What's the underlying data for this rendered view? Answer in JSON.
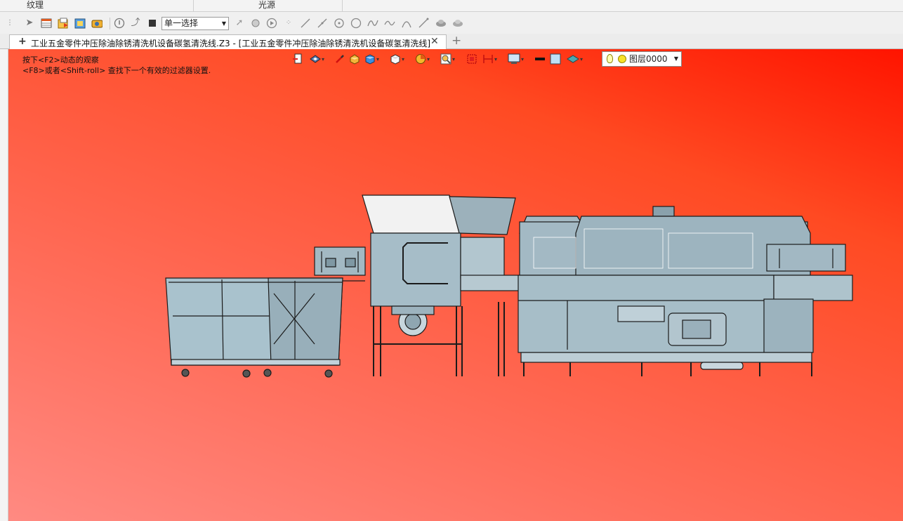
{
  "ribbon": {
    "labels": [
      "纹理",
      "光源"
    ]
  },
  "toolbar": {
    "icons": [
      "menu-grip-icon",
      "cursor-icon",
      "table-icon",
      "import-icon",
      "export-icon",
      "screenshot-icon",
      "compass-icon",
      "path-icon",
      "stop-icon"
    ],
    "select_value": "单一选择",
    "tool_icons": [
      "pick-arrow-icon",
      "pick-sphere-icon",
      "play-icon",
      "points-icon",
      "line-icon",
      "line2-icon",
      "circle-center-icon",
      "circle-icon",
      "spline-icon",
      "curve-icon",
      "arc-icon",
      "segment-icon",
      "cloud-icon",
      "cloud2-icon"
    ]
  },
  "tabs": {
    "active_title": "工业五金零件冲压除油除锈清洗机设备碳氢清洗线.Z3 - [工业五金零件冲压除油除锈清洗机设备碳氢清洗线]",
    "plus": "+",
    "close": "✕",
    "new_tab": "+"
  },
  "viewport": {
    "hint_line1": "按下<F2>动态的观察",
    "hint_line2": "<F8>或者<Shift-roll> 查找下一个有效的过滤器设置.",
    "gradient_colors": [
      "#ff1400",
      "#ff8a82"
    ],
    "view_icons": [
      "exit-icon",
      "view-orient-icon",
      "pen-icon",
      "box-yellow-icon",
      "cube-blue-icon",
      "cube-white-icon",
      "render-mode-icon",
      "zoom-fit-icon",
      "red-box-icon",
      "section-icon",
      "display-icon",
      "color-black-icon",
      "color-lightblue-icon",
      "layer-style-icon"
    ],
    "layer_value": "图层0000"
  }
}
